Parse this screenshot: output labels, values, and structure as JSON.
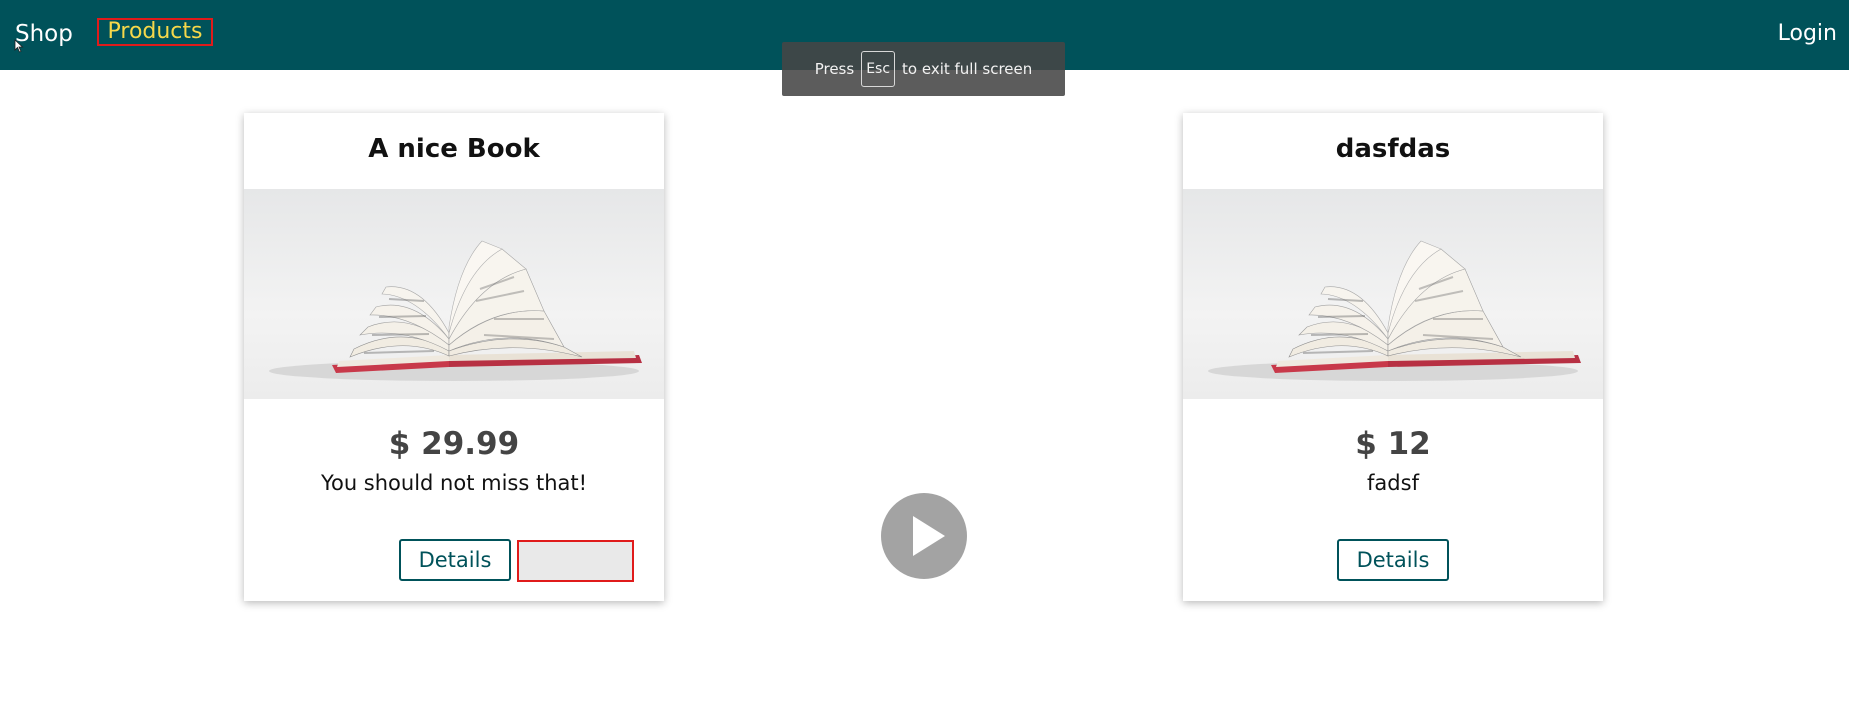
{
  "nav": {
    "shop_label": "Shop",
    "products_label": "Products",
    "login_label": "Login"
  },
  "fullscreen_notice": {
    "before": "Press",
    "key": "Esc",
    "after": "to exit full screen"
  },
  "products": [
    {
      "title": "A nice Book",
      "price": "$ 29.99",
      "description": "You should not miss that!",
      "details_label": "Details",
      "image_icon": "open-book-photo"
    },
    {
      "title": "dasfdas",
      "price": "$ 12",
      "description": "fadsf",
      "details_label": "Details",
      "image_icon": "open-book-photo"
    }
  ],
  "colors": {
    "topbar": "#00525a",
    "products_text": "#f6d84a",
    "highlight_border": "#e01b1b",
    "details_border": "#00525a"
  },
  "icons": {
    "play": "play-icon",
    "cursor": "mouse-pointer-icon"
  }
}
